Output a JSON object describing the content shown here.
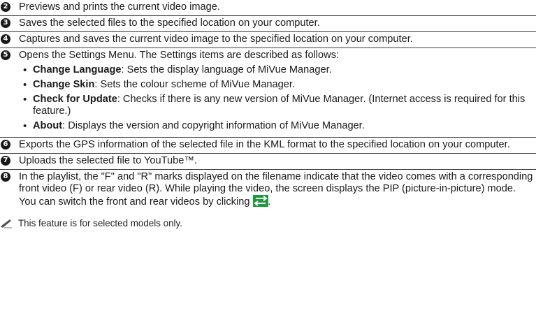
{
  "items": [
    {
      "num": "2",
      "text": "Previews and prints the current video image."
    },
    {
      "num": "3",
      "text": "Saves the selected files to the specified location on your computer."
    },
    {
      "num": "4",
      "text": "Captures and saves the current video image to the specified location on your computer."
    },
    {
      "num": "5",
      "text": "Opens the Settings Menu. The Settings items are described as follows:",
      "bullets": [
        {
          "bold": "Change Language",
          "text": ": Sets the display language of MiVue Manager."
        },
        {
          "bold": "Change Skin",
          "text": ": Sets the colour scheme of MiVue Manager."
        },
        {
          "bold": "Check for Update",
          "text": ": Checks if there is any new version of MiVue Manager. (Internet access is required for this feature.)"
        },
        {
          "bold": "About",
          "text": ": Displays the version and copyright information of MiVue Manager."
        }
      ]
    },
    {
      "num": "6",
      "text": "Exports the GPS information of the selected file in the KML format to the specified location on your computer."
    },
    {
      "num": "7",
      "text": "Uploads the selected file to YouTube™."
    },
    {
      "num": "8",
      "text": "In the playlist, the \"F\" and \"R\" marks displayed on the filename indicate that the video comes with a corresponding front video (F) or rear video (R). While playing the video, the screen displays the PIP (picture-in-picture) mode. You can switch the front and rear videos by clicking",
      "text_after_icon": ".",
      "icon": "swap-arrows-icon"
    }
  ],
  "note": {
    "icon": "note-pen-icon",
    "text": "This feature is for selected models only."
  },
  "colors": {
    "icon_green": "#1a9b3c",
    "text": "#1a1a1a",
    "rule": "#3a3a3a"
  }
}
